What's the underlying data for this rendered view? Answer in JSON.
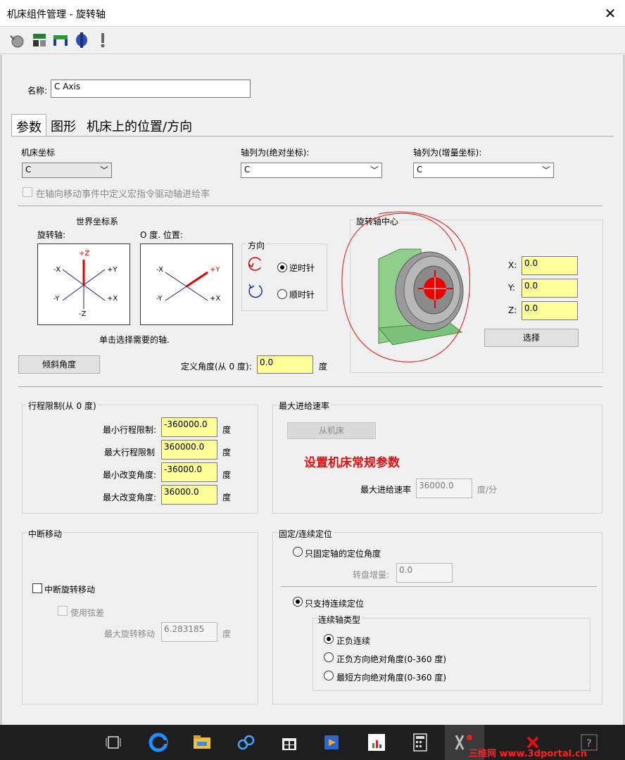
{
  "window": {
    "title": "机床组件管理 - 旋转轴",
    "close_glyph": "✕"
  },
  "toolbar": {
    "icons": [
      "rotary-gear-icon",
      "module-icon",
      "bracket-icon",
      "axis-icon",
      "warning-icon"
    ]
  },
  "name_field": {
    "label": "名称:",
    "value": "C Axis"
  },
  "tabs": [
    {
      "label": "参数"
    },
    {
      "label": "图形"
    },
    {
      "label": "机床上的位置/方向"
    }
  ],
  "machine_coord": {
    "label": "机床坐标",
    "value": "C"
  },
  "axis_abs": {
    "label": "轴列为(绝对坐标):",
    "value": "C"
  },
  "axis_inc": {
    "label": "轴列为(增量坐标):",
    "value": "C"
  },
  "macro_check": {
    "label": "在轴向移动事件中定义宏指令驱动轴进给率"
  },
  "world": {
    "title": "世界坐标系",
    "rot_axis_label": "旋转轴:",
    "zero_pos_label": "O 度. 位置:",
    "rot_diagram": {
      "pz": "+Z",
      "py": "+Y",
      "px": "+X",
      "nx": "-X",
      "ny": "-Y",
      "nz": "-Z"
    },
    "zero_diagram": {
      "py": "+Y",
      "px": "+X",
      "nx": "-X",
      "ny": "-Y"
    },
    "hint": "单击选择需要的轴.",
    "tilt_button": "倾斜角度",
    "define_angle_label": "定义角度(从 0 度):",
    "define_angle_value": "0.0",
    "define_angle_unit": "度"
  },
  "direction": {
    "title": "方向",
    "ccw_label": "逆时针",
    "cw_label": "顺时针"
  },
  "center": {
    "title": "旋转轴中心",
    "x_label": "X:",
    "x_value": "0.0",
    "y_label": "Y:",
    "y_value": "0.0",
    "z_label": "Z:",
    "z_value": "0.0",
    "select_button": "选择"
  },
  "travel": {
    "title": "行程限制(从 0 度)",
    "min_label": "最小行程限制:",
    "min_value": "-360000.0",
    "max_label": "最大行程限制",
    "max_value": "360000.0",
    "min_change_label": "最小改变角度:",
    "min_change_value": "-36000.0",
    "max_change_label": "最大改变角度:",
    "max_change_value": "36000.0",
    "unit": "度"
  },
  "feed": {
    "title": "最大进给速率",
    "from_machine_button": "从机床",
    "annotation": "设置机床常规参数",
    "max_label": "最大进给速率",
    "max_value": "36000.0",
    "unit": "度/分"
  },
  "break_move": {
    "title": "中断移动",
    "break_check": "中断旋转移动",
    "chord_check": "使用弦差",
    "max_rot_label": "最大旋转移动",
    "max_rot_value": "6.283185",
    "unit": "度"
  },
  "positioning": {
    "title": "固定/连续定位",
    "fixed_radio": "只固定轴的定位角度",
    "table_inc_label": "转盘增量:",
    "table_inc_value": "0.0",
    "continuous_radio": "只支持连续定位",
    "cont_type_title": "连续轴类型",
    "opt1": "正负连续",
    "opt2": "正负方向绝对角度(0-360 度)",
    "opt3": "最短方向绝对角度(0-360 度)"
  },
  "taskbar": {
    "icons": [
      "task-view-icon",
      "edge-icon",
      "file-explorer-icon",
      "network-icon",
      "store-icon",
      "media-icon",
      "chart-app-icon",
      "calculator-icon",
      "cad-app-icon",
      "close-red-icon",
      "help-icon"
    ],
    "watermark": "三维网 www.3dportal.cn"
  },
  "colors": {
    "yellow_field": "#ffff99",
    "accent_red": "#dd1111",
    "green_body": "#8fce8c"
  }
}
